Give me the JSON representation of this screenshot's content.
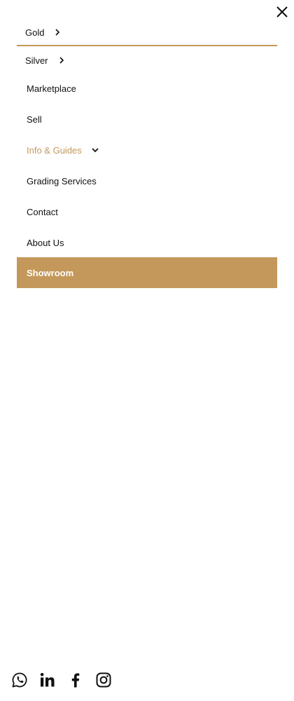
{
  "header": {
    "close_icon": "close-icon"
  },
  "menu": {
    "items": [
      {
        "label": "Gold",
        "icon": "chevron-right-icon"
      },
      {
        "label": "Silver",
        "icon": "chevron-right-icon"
      },
      {
        "label": "Marketplace"
      },
      {
        "label": "Sell"
      },
      {
        "label": "Info & Guides",
        "icon": "chevron-down-icon",
        "active": true
      },
      {
        "label": "Grading Services"
      },
      {
        "label": "Contact"
      },
      {
        "label": "About Us"
      },
      {
        "label": "Showroom",
        "highlighted": true
      }
    ]
  },
  "social": {
    "icons": [
      "whatsapp-icon",
      "linkedin-icon",
      "facebook-icon",
      "instagram-icon"
    ]
  },
  "colors": {
    "accent": "#c4985a",
    "text": "#111111",
    "background": "#ffffff",
    "highlight_text": "#ffffff"
  }
}
